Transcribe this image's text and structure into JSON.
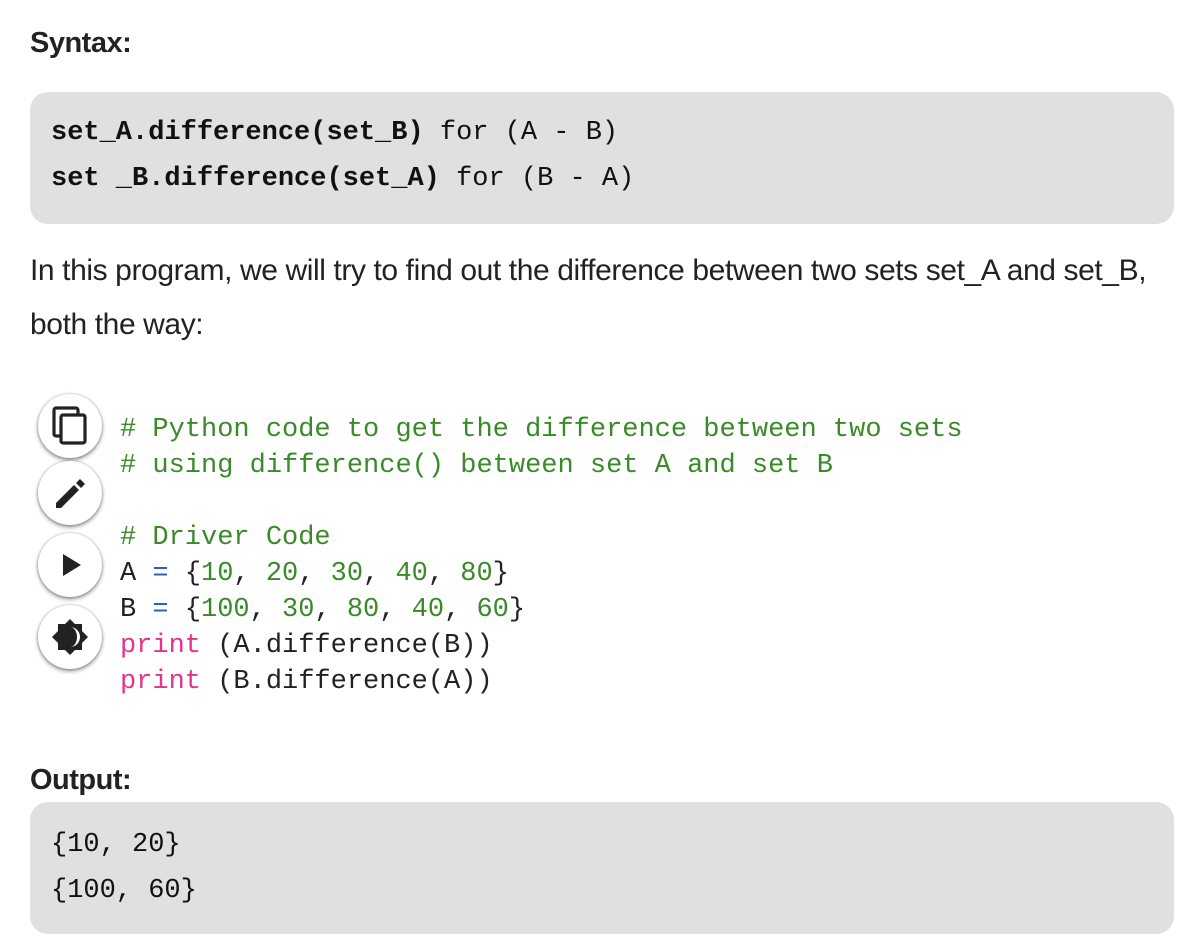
{
  "syntax": {
    "heading": "Syntax:",
    "lines": [
      {
        "code": "set_A.difference(set_B)",
        "suffix": " for (A - B)"
      },
      {
        "code": "set _B.difference(set_A)",
        "suffix": " for (B - A)"
      }
    ]
  },
  "paragraph": "In this program, we will try to find out the difference between two sets set_A and set_B, both the way:",
  "toolbar": {
    "copy_icon": "copy-icon",
    "edit_icon": "pencil-icon",
    "run_icon": "play-icon",
    "theme_icon": "brightness-icon"
  },
  "code": {
    "comment1": "# Python code to get the difference between two sets",
    "comment2": "# using difference() between set A and set B",
    "comment3": "# Driver Code",
    "lineA": {
      "name": "A",
      "op": "=",
      "open": "{",
      "nums": [
        "10",
        "20",
        "30",
        "40",
        "80"
      ],
      "close": "}"
    },
    "lineB": {
      "name": "B",
      "op": "=",
      "open": "{",
      "nums": [
        "100",
        "30",
        "80",
        "40",
        "60"
      ],
      "close": "}"
    },
    "print1": {
      "kw": "print",
      "args": " (A.difference(B))"
    },
    "print2": {
      "kw": "print",
      "args": " (B.difference(A))"
    }
  },
  "output": {
    "heading": "Output:",
    "lines": [
      "{10, 20}",
      "{100, 60}"
    ]
  },
  "colors": {
    "comment": "#3a8a2a",
    "keyword": "#e0368e",
    "operator": "#2a62b8",
    "box_background": "#e0e0e0"
  }
}
